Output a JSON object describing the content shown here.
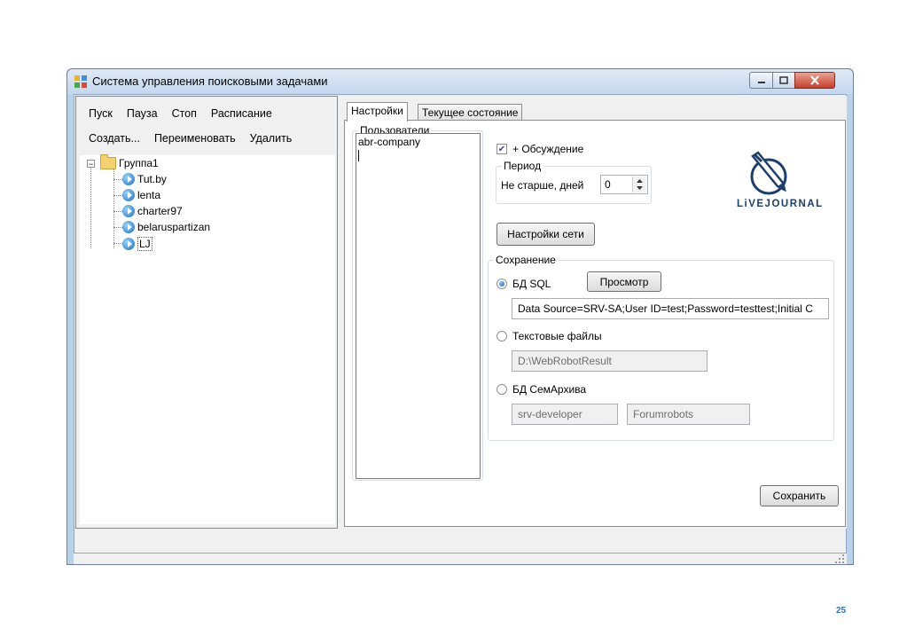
{
  "window": {
    "title": "Система управления поисковыми задачами"
  },
  "left_panel": {
    "menu_row1": [
      "Пуск",
      "Пауза",
      "Стоп",
      "Расписание"
    ],
    "menu_row2": [
      "Создать...",
      "Переименовать",
      "Удалить"
    ],
    "tree": {
      "group": "Группа1",
      "items": [
        "Tut.by",
        "lenta",
        "charter97",
        "belaruspartizan",
        "LJ"
      ],
      "selected": "LJ"
    }
  },
  "tabs": [
    "Настройки",
    "Текущее состояние"
  ],
  "active_tab": "Настройки",
  "settings": {
    "users_legend": "Пользователи",
    "users": [
      "abr-company"
    ],
    "discussion_label": "+ Обсуждение",
    "discussion_checked": true,
    "period_legend": "Период",
    "period_label": "Не старше, дней",
    "period_value": "0",
    "network_button": "Настройки сети",
    "logo_text": "LiVEJOURNAL",
    "save_legend": "Сохранение",
    "db_sql_label": "БД SQL",
    "db_sql_selected": true,
    "browse_button": "Просмотр",
    "connection_string": "Data Source=SRV-SA;User ID=test;Password=testtest;Initial C",
    "text_files_label": "Текстовые файлы",
    "text_files_path": "D:\\WebRobotResult",
    "semarchive_label": "БД СемАрхива",
    "semarchive_server": "srv-developer",
    "semarchive_db": "Forumrobots",
    "save_button": "Сохранить"
  },
  "colors": {
    "accent": "#1e6fc4",
    "page_number": "#2c73c8"
  },
  "page_number": "25"
}
